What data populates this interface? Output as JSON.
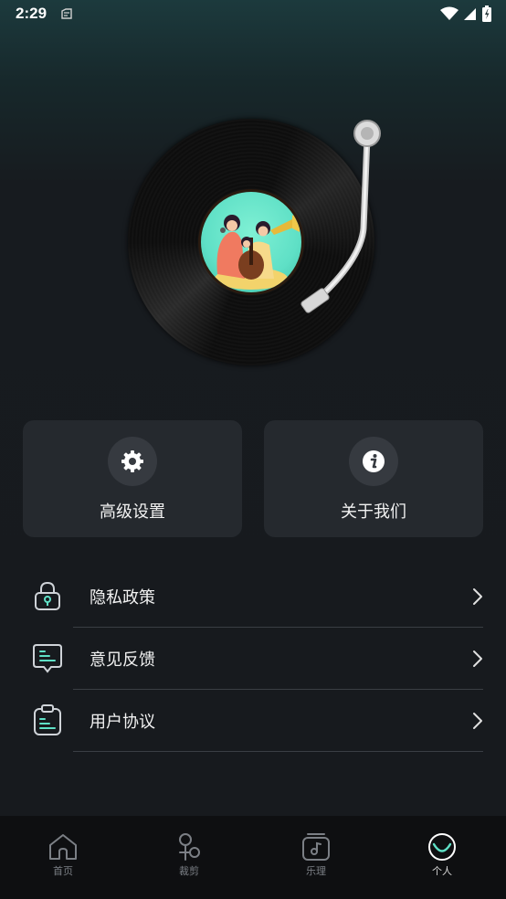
{
  "status_bar": {
    "time": "2:29"
  },
  "cards": [
    {
      "label": "高级设置",
      "icon": "gear-icon"
    },
    {
      "label": "关于我们",
      "icon": "info-icon"
    }
  ],
  "menu": [
    {
      "label": "隐私政策",
      "icon": "lock-icon"
    },
    {
      "label": "意见反馈",
      "icon": "feedback-icon"
    },
    {
      "label": "用户协议",
      "icon": "clipboard-icon"
    }
  ],
  "bottom_nav": [
    {
      "label": "首页",
      "icon": "home-icon",
      "active": false
    },
    {
      "label": "裁剪",
      "icon": "scissors-icon",
      "active": false
    },
    {
      "label": "乐理",
      "icon": "music-note-icon",
      "active": false
    },
    {
      "label": "个人",
      "icon": "smiley-icon",
      "active": true
    }
  ],
  "colors": {
    "background": "#171a1e",
    "card": "#25292e",
    "accent": "#5fe0c6",
    "nav_bg": "#0e0f11"
  }
}
